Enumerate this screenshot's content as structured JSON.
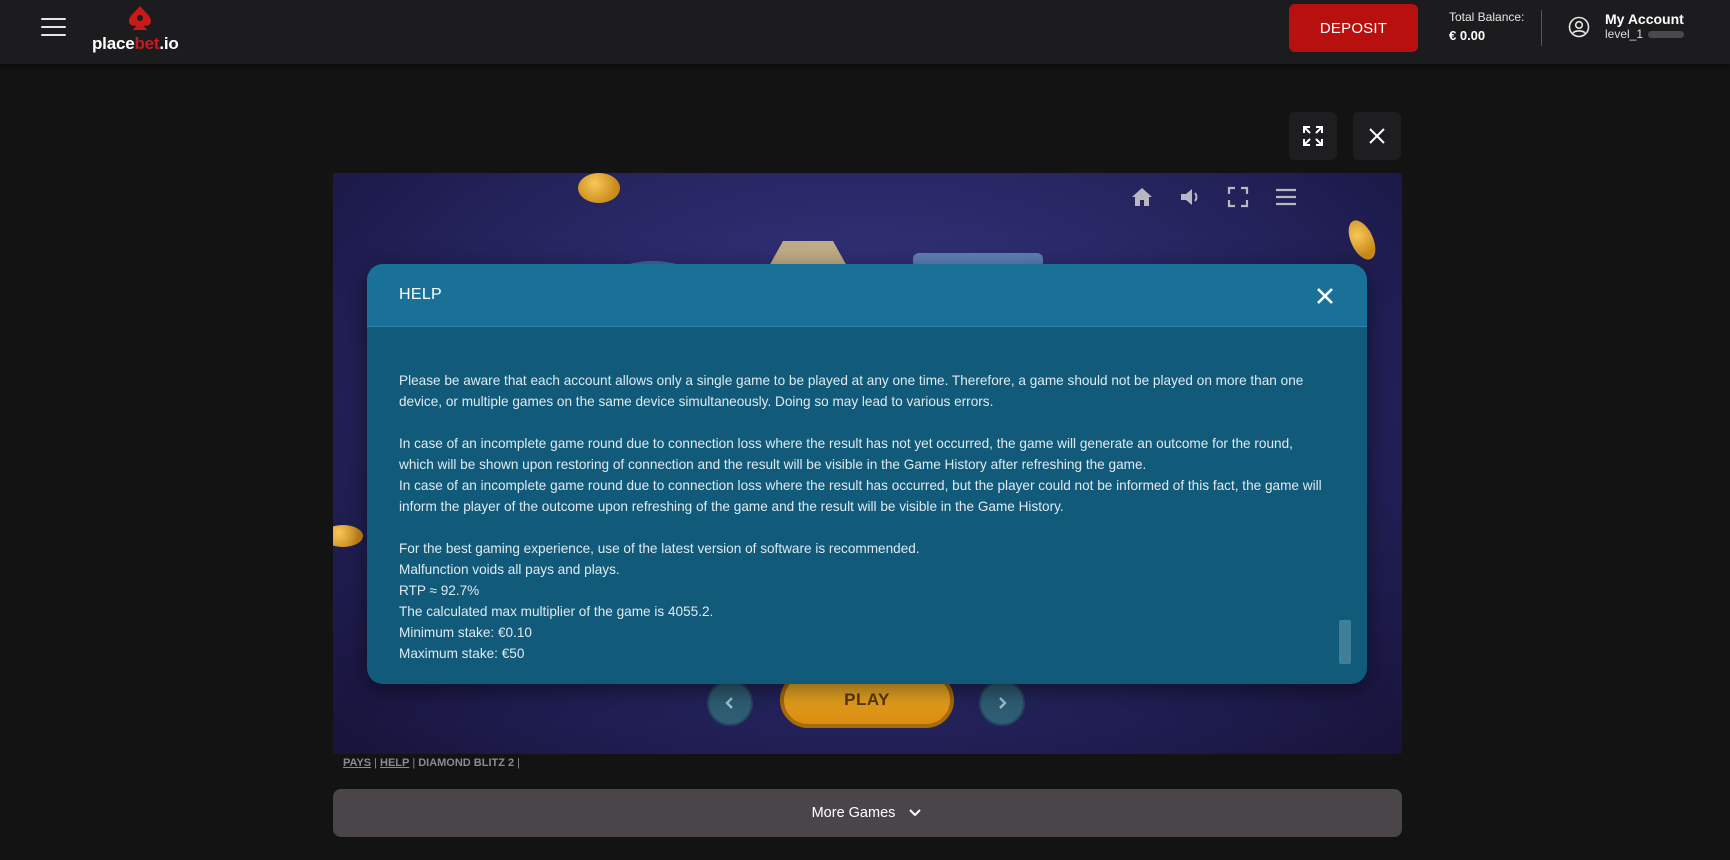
{
  "header": {
    "logo": {
      "part1": "place",
      "part2": "bet",
      "part3": ".io"
    },
    "deposit_label": "DEPOSIT",
    "balance_label": "Total Balance:",
    "balance_value": "€ 0.00",
    "account_name": "My Account",
    "account_level": "level_1"
  },
  "game_toolbar": {
    "icons": [
      "home-icon",
      "sound-icon",
      "fullscreen-icon",
      "menu-icon"
    ]
  },
  "game": {
    "play_label": "PLAY"
  },
  "help": {
    "title": "HELP",
    "paragraphs": [
      "Please be aware that each account allows only a single game to be played at any one time. Therefore, a game should not be played on more than one device, or multiple games on the same device simultaneously. Doing so may lead to various errors.",
      "In case of an incomplete game round due to connection loss where the result has not yet occurred, the game will generate an outcome for the round, which will be shown upon restoring of connection and the result will be visible in the Game History after refreshing the game.",
      "In case of an incomplete game round due to connection loss where the result has occurred, but the player could not be informed of this fact, the game will inform the player of the outcome upon refreshing of the game and the result will be visible in the Game History.",
      "For the best gaming experience, use of the latest version of software is recommended.",
      "Malfunction voids all pays and plays.",
      "RTP ≈ 92.7%",
      "The calculated max multiplier of the game is 4055.2.",
      "Minimum stake: €0.10",
      "Maximum stake: €50"
    ]
  },
  "game_links": {
    "pays": "PAYS",
    "help": "HELP",
    "game_name": "DIAMOND BLITZ 2",
    "separator": "|"
  },
  "more_games_label": "More Games",
  "colors": {
    "deposit": "#b80f0f",
    "modal_bg": "#115a7a",
    "modal_header": "#1a7197",
    "play_button": "#f6b82c"
  }
}
